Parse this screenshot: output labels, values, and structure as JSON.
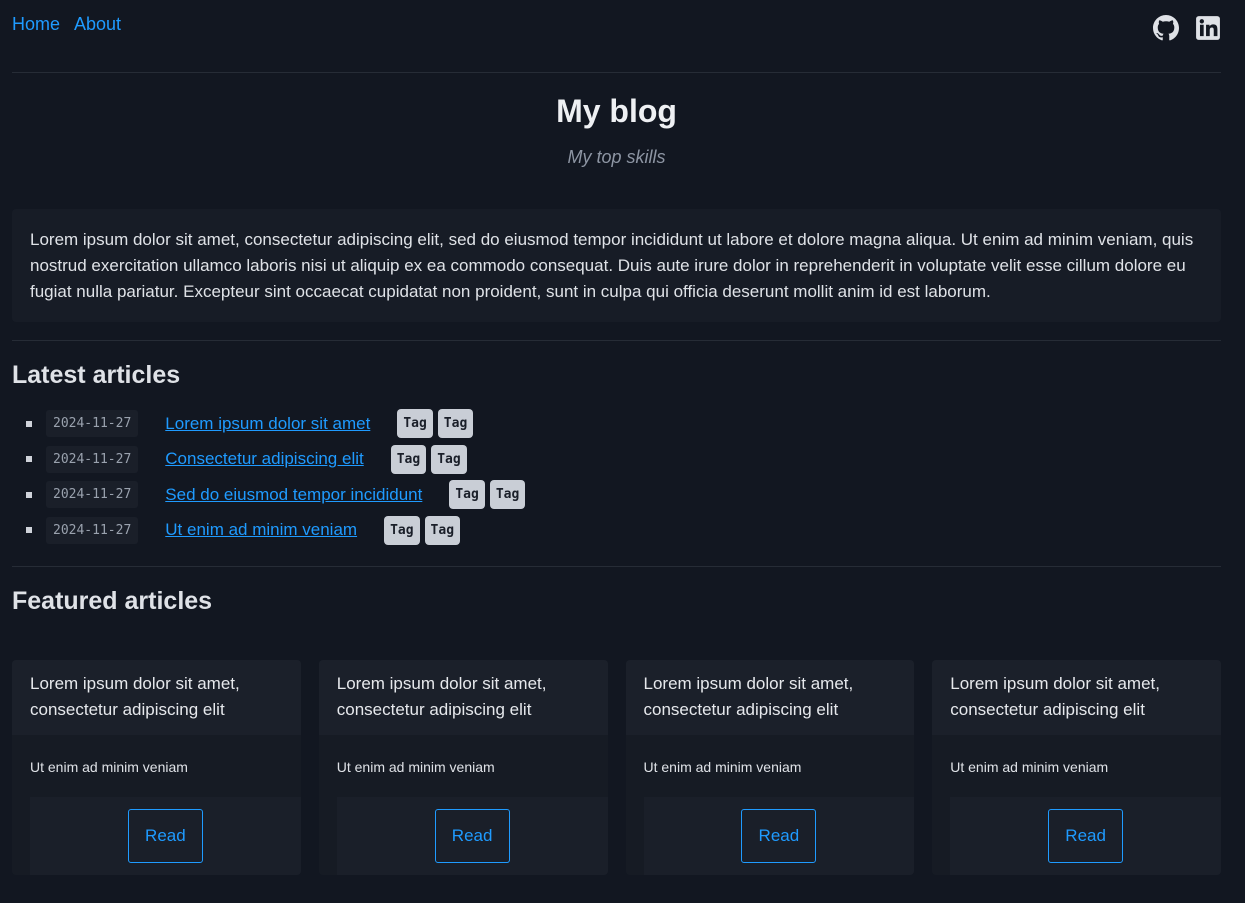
{
  "nav": {
    "links": [
      "Home",
      "About"
    ],
    "social": [
      "github-icon",
      "linkedin-icon"
    ]
  },
  "header": {
    "title": "My blog",
    "subtitle": "My top skills"
  },
  "intro": {
    "text": "Lorem ipsum dolor sit amet, consectetur adipiscing elit, sed do eiusmod tempor incididunt ut labore et dolore magna aliqua. Ut enim ad minim veniam, quis nostrud exercitation ullamco laboris nisi ut aliquip ex ea commodo consequat. Duis aute irure dolor in reprehenderit in voluptate velit esse cillum dolore eu fugiat nulla pariatur. Excepteur sint occaecat cupidatat non proident, sunt in culpa qui officia deserunt mollit anim id est laborum."
  },
  "latest": {
    "heading": "Latest articles",
    "items": [
      {
        "date": "2024-11-27",
        "title": "Lorem ipsum dolor sit amet",
        "tags": [
          "Tag",
          "Tag"
        ]
      },
      {
        "date": "2024-11-27",
        "title": "Consectetur adipiscing elit",
        "tags": [
          "Tag",
          "Tag"
        ]
      },
      {
        "date": "2024-11-27",
        "title": "Sed do eiusmod tempor incididunt",
        "tags": [
          "Tag",
          "Tag"
        ]
      },
      {
        "date": "2024-11-27",
        "title": "Ut enim ad minim veniam",
        "tags": [
          "Tag",
          "Tag"
        ]
      }
    ]
  },
  "featured": {
    "heading": "Featured articles",
    "cards": [
      {
        "title": "Lorem ipsum dolor sit amet, consectetur adipiscing elit",
        "summary": "Ut enim ad minim veniam",
        "button": "Read"
      },
      {
        "title": "Lorem ipsum dolor sit amet, consectetur adipiscing elit",
        "summary": "Ut enim ad minim veniam",
        "button": "Read"
      },
      {
        "title": "Lorem ipsum dolor sit amet, consectetur adipiscing elit",
        "summary": "Ut enim ad minim veniam",
        "button": "Read"
      },
      {
        "title": "Lorem ipsum dolor sit amet, consectetur adipiscing elit",
        "summary": "Ut enim ad minim veniam",
        "button": "Read"
      }
    ]
  },
  "colors": {
    "background": "#121721",
    "accent": "#1f9bff",
    "tag_bg": "#c9ced6"
  }
}
